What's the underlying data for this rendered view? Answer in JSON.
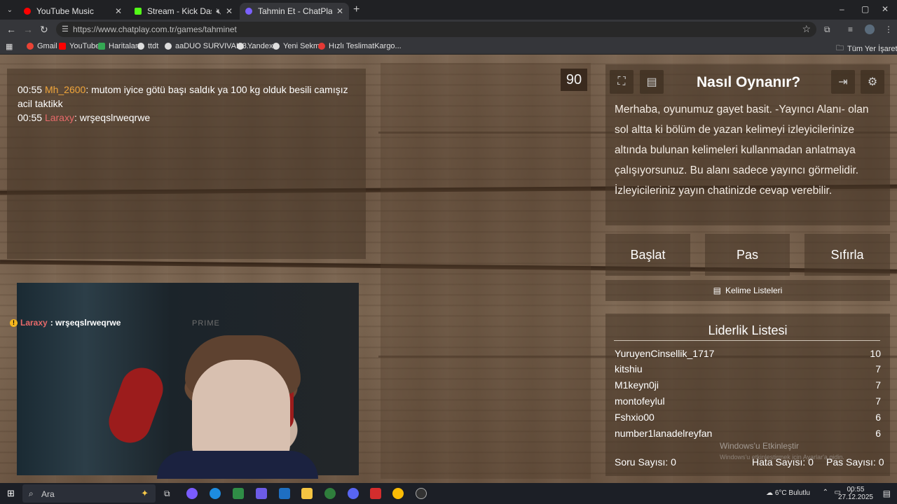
{
  "browser": {
    "tabs": [
      {
        "label": "YouTube Music",
        "favicon_color": "#ff0000",
        "active": false
      },
      {
        "label": "Stream - Kick Dashboard",
        "favicon_color": "#53fc18",
        "active": false
      },
      {
        "label": "Tahmin Et - ChatPlay",
        "favicon_color": "#7b61ff",
        "active": true
      }
    ],
    "new_tab": "+",
    "window_controls": [
      "–",
      "▢",
      "✕"
    ],
    "url": "https://www.chatplay.com.tr/games/tahminet",
    "bookmarks": [
      "Gmail",
      "YouTube",
      "Haritalar",
      "ttdt",
      "aaDUO SURVIVAL 3...",
      "Yandex",
      "Yeni Sekme",
      "Hızlı TeslimatKargo..."
    ],
    "all_bookmarks": "Tüm Yer İşaretleri"
  },
  "chat": {
    "messages": [
      {
        "time": "00:55",
        "user": "Mh_2600",
        "text": ": mutom iyice götü başı saldık ya 100 kg olduk besili camışız acil taktikk"
      },
      {
        "time": "00:55",
        "user": "Laraxy",
        "text": ": wrşeqslrweqrwe"
      }
    ]
  },
  "camera_overlay": {
    "user": "Laraxy",
    "text": " : wrşeqslrweqrwe",
    "chair_brand": "PRIME"
  },
  "timer": "90",
  "howto": {
    "title": "Nasıl Oynanır?",
    "text": "Merhaba, oyunumuz gayet basit. -Yayıncı Alanı- olan sol altta ki bölüm de yazan kelimeyi izleyicilerinize altında bulunan kelimeleri kullanmadan anlatmaya çalışıyorsunuz. Bu alanı sadece yayıncı görmelidir. İzleyicileriniz yayın chatinizde cevap verebilir."
  },
  "controls": {
    "start": "Başlat",
    "pass": "Pas",
    "reset": "Sıfırla",
    "word_lists": "Kelime Listeleri"
  },
  "leaderboard": {
    "title": "Liderlik Listesi",
    "rows": [
      {
        "name": "YuruyenCinsellik_1717",
        "score": "10"
      },
      {
        "name": "kitshiu",
        "score": "7"
      },
      {
        "name": "M1keyn0ji",
        "score": "7"
      },
      {
        "name": "montofeylul",
        "score": "7"
      },
      {
        "name": "Fshxio00",
        "score": "6"
      },
      {
        "name": "number1lanadelreyfan",
        "score": "6"
      }
    ]
  },
  "stats": {
    "questions": "Soru Sayısı: 0",
    "errors": "Hata Sayısı: 0",
    "passes": "Pas Sayısı: 0"
  },
  "watermark": {
    "line1": "Windows'u Etkinleştir",
    "line2": "Windows'u etkinleştirmek için Ayarlar'a gidin."
  },
  "taskbar": {
    "search_placeholder": "Ara",
    "weather": "6°C  Bulutlu",
    "time": "00:55",
    "date": "27.12.2025"
  }
}
